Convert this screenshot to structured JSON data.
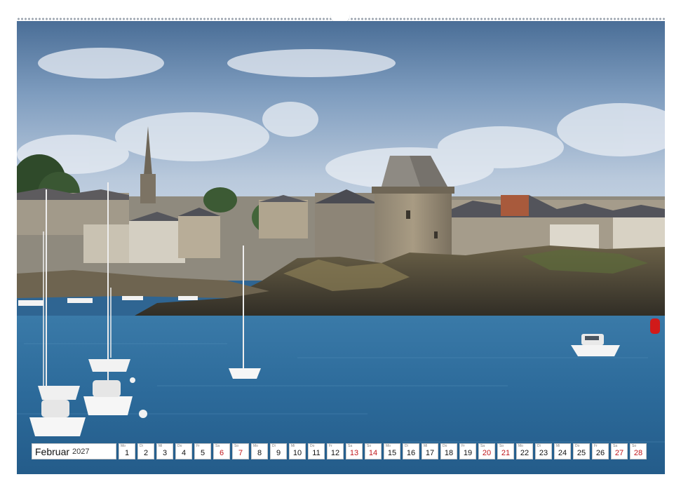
{
  "calendar": {
    "month": "Februar",
    "year": "2027",
    "days": [
      {
        "day": "1",
        "weekday": "Mo",
        "weekend": false
      },
      {
        "day": "2",
        "weekday": "Di",
        "weekend": false
      },
      {
        "day": "3",
        "weekday": "Mi",
        "weekend": false
      },
      {
        "day": "4",
        "weekday": "Do",
        "weekend": false
      },
      {
        "day": "5",
        "weekday": "Fr",
        "weekend": false
      },
      {
        "day": "6",
        "weekday": "Sa",
        "weekend": true
      },
      {
        "day": "7",
        "weekday": "So",
        "weekend": true
      },
      {
        "day": "8",
        "weekday": "Mo",
        "weekend": false
      },
      {
        "day": "9",
        "weekday": "Di",
        "weekend": false
      },
      {
        "day": "10",
        "weekday": "Mi",
        "weekend": false
      },
      {
        "day": "11",
        "weekday": "Do",
        "weekend": false
      },
      {
        "day": "12",
        "weekday": "Fr",
        "weekend": false
      },
      {
        "day": "13",
        "weekday": "Sa",
        "weekend": true
      },
      {
        "day": "14",
        "weekday": "So",
        "weekend": true
      },
      {
        "day": "15",
        "weekday": "Mo",
        "weekend": false
      },
      {
        "day": "16",
        "weekday": "Di",
        "weekend": false
      },
      {
        "day": "17",
        "weekday": "Mi",
        "weekend": false
      },
      {
        "day": "18",
        "weekday": "Do",
        "weekend": false
      },
      {
        "day": "19",
        "weekday": "Fr",
        "weekend": false
      },
      {
        "day": "20",
        "weekday": "Sa",
        "weekend": true
      },
      {
        "day": "21",
        "weekday": "So",
        "weekend": true
      },
      {
        "day": "22",
        "weekday": "Mo",
        "weekend": false
      },
      {
        "day": "23",
        "weekday": "Di",
        "weekend": false
      },
      {
        "day": "24",
        "weekday": "Mi",
        "weekend": false
      },
      {
        "day": "25",
        "weekday": "Do",
        "weekend": false
      },
      {
        "day": "26",
        "weekday": "Fr",
        "weekend": false
      },
      {
        "day": "27",
        "weekday": "Sa",
        "weekend": true
      },
      {
        "day": "28",
        "weekday": "So",
        "weekend": true
      }
    ]
  },
  "colors": {
    "weekend_number": "#c0161b",
    "weekday_number": "#111111",
    "cell_border": "#c9c9c9"
  }
}
